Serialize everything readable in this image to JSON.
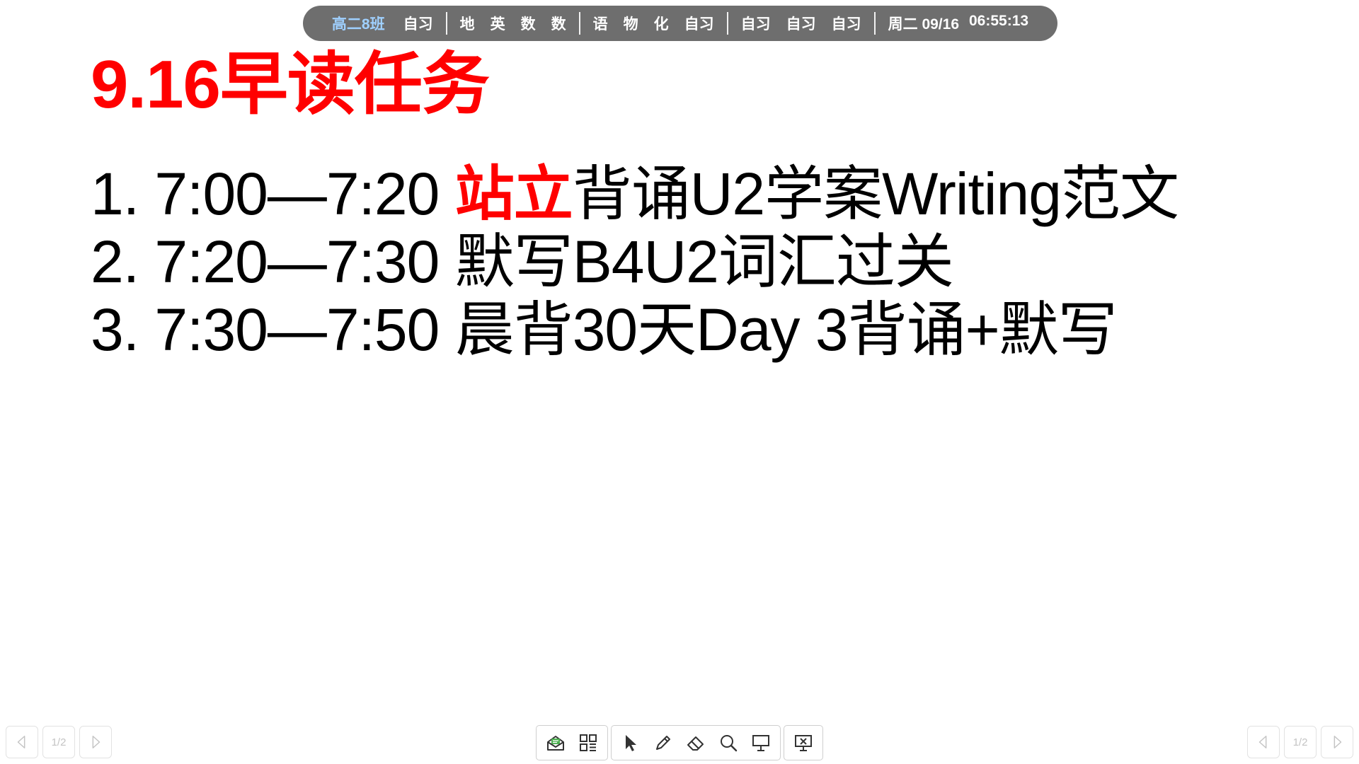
{
  "topbar": {
    "class_name": "高二8班",
    "group1": [
      "自习"
    ],
    "group2": [
      "地",
      "英",
      "数",
      "数"
    ],
    "group3": [
      "语",
      "物",
      "化",
      "自习"
    ],
    "group4": [
      "自习",
      "自习",
      "自习"
    ],
    "date": "周二 09/16",
    "time": "06:55:13"
  },
  "slide": {
    "title": "9.16早读任务",
    "tasks": [
      {
        "prefix": "1. 7:00—7:20 ",
        "highlight": "站立",
        "text": "背诵U2学案Writing范文"
      },
      {
        "prefix": "2. 7:20—7:30 ",
        "highlight": "",
        "text": "默写B4U2词汇过关"
      },
      {
        "prefix": "3. 7:30—7:50 ",
        "highlight": "",
        "text": "晨背30天Day 3背诵+默写"
      }
    ],
    "highlight_color": "#ff0000"
  },
  "pager": {
    "left_page": "1/2",
    "right_page": "1/2"
  },
  "toolbar": {
    "icons": [
      "inbox-icon",
      "qr-code-icon",
      "pointer-icon",
      "pen-icon",
      "eraser-icon",
      "search-icon",
      "screen-icon",
      "exit-icon"
    ]
  }
}
